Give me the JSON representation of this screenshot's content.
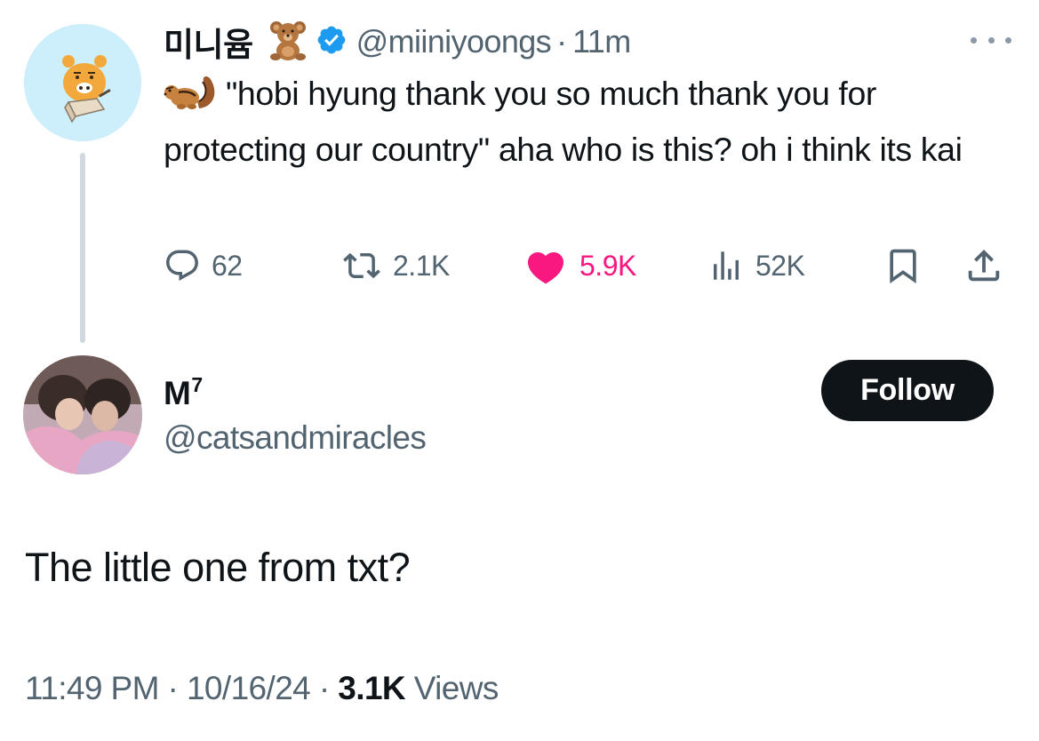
{
  "parent": {
    "display_name": "미니윰",
    "handle": "@miiniyoongs",
    "separator": "·",
    "time": "11m",
    "text": "\"hobi hyung thank you so much thank you for protecting our country\" aha who is this? oh i think its kai",
    "stats": {
      "replies": "62",
      "reposts": "2.1K",
      "likes": "5.9K",
      "views": "52K"
    }
  },
  "reply": {
    "display_name": "M",
    "name_superscript": "7",
    "handle": "@catsandmiracles",
    "follow_label": "Follow",
    "text": "The little one from txt?",
    "time": "11:49 PM",
    "separator": "·",
    "date": "10/16/24",
    "views_count": "3.1K",
    "views_label": "Views"
  },
  "colors": {
    "text": "#0f1419",
    "secondary": "#536471",
    "like": "#f91880",
    "verified": "#1d9bf0",
    "thread_line": "#cfd9de"
  },
  "icons": [
    "chipmunk-emoji-icon",
    "teddy-bear-emoji-icon",
    "verified-badge-icon",
    "more-icon",
    "reply-icon",
    "repost-icon",
    "like-icon",
    "views-icon",
    "bookmark-icon",
    "share-icon"
  ]
}
